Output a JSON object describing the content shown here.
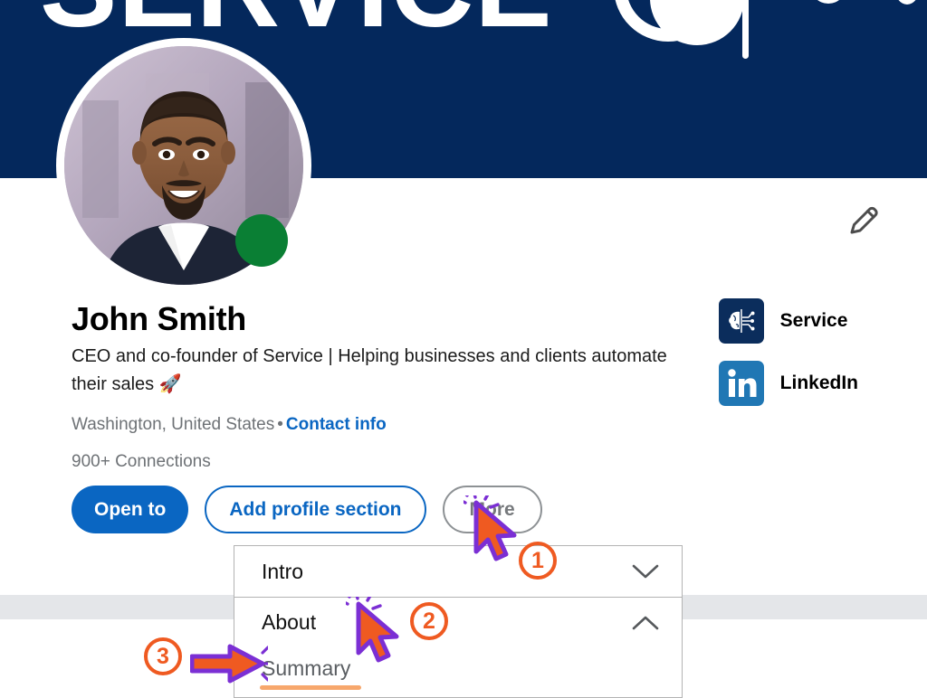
{
  "banner": {
    "title": "SERVICE",
    "background_color": "#04285C",
    "art_name": "abstract-network-graphic"
  },
  "profile": {
    "name": "John Smith",
    "headline": "CEO and co-founder of Service | Helping businesses and clients automate their sales 🚀",
    "location": "Washington, United States",
    "meta_separator": "•",
    "contact_info_label": "Contact info",
    "connections": "900+ Connections",
    "status_badge_color": "#0A7F34",
    "edit_icon": "pencil-icon"
  },
  "organizations": [
    {
      "label": "Service",
      "logo": "brain-circuit-logo",
      "logo_color": "#0B2D5C"
    },
    {
      "label": "LinkedIn",
      "logo": "linkedin-logo",
      "logo_color": "#2077B4"
    }
  ],
  "actions": {
    "open_to": "Open to",
    "add_profile_section": "Add profile section",
    "more": "More",
    "primary_color": "#0A66C2",
    "gray_color": "#76797C"
  },
  "dropdown": {
    "rows": [
      {
        "label": "Intro",
        "chevron": "chevron-down-icon",
        "expanded": false
      },
      {
        "label": "About",
        "chevron": "chevron-up-icon",
        "expanded": true
      }
    ],
    "sub_items": [
      {
        "label": "Summary",
        "highlighted": true,
        "highlight_color": "#F7A76C"
      }
    ]
  },
  "annotations": {
    "accent_color": "#EF5A21",
    "cursor_outline_color": "#7B2FD4",
    "steps": [
      {
        "number": "1",
        "marker": "cursor-pointer-icon",
        "target": "add-profile-section-button"
      },
      {
        "number": "2",
        "marker": "cursor-pointer-icon",
        "target": "dropdown-row-about"
      },
      {
        "number": "3",
        "marker": "arrow-right-icon",
        "target": "dropdown-subitem-summary"
      }
    ]
  }
}
